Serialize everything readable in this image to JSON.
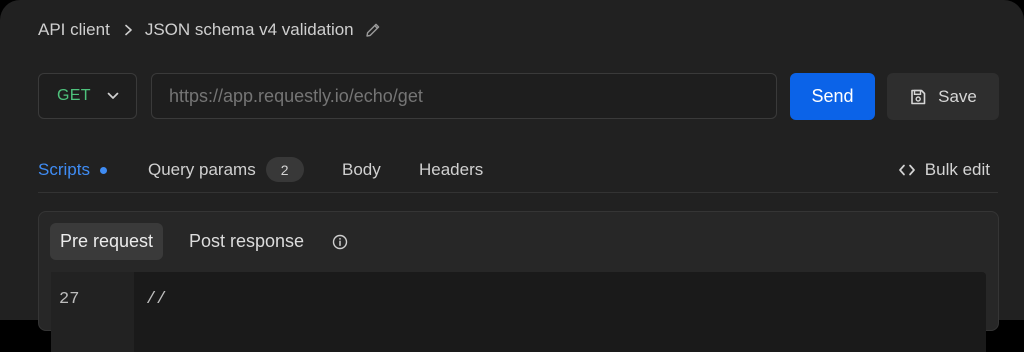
{
  "breadcrumb": {
    "root": "API client",
    "current": "JSON schema v4 validation",
    "separator_icon": "chevron-right-icon",
    "edit_icon": "pencil-icon"
  },
  "request": {
    "method": "GET",
    "method_color": "#4ec27c",
    "url_placeholder": "https://app.requestly.io/echo/get",
    "send_label": "Send",
    "send_color": "#0b63e8",
    "save_label": "Save",
    "save_icon": "floppy-disk-icon"
  },
  "tabs": [
    {
      "label": "Scripts",
      "active": true,
      "dot": true
    },
    {
      "label": "Query params",
      "count": "2"
    },
    {
      "label": "Body"
    },
    {
      "label": "Headers"
    }
  ],
  "bulk_edit": {
    "label": "Bulk edit",
    "icon": "code-brackets-icon"
  },
  "scripts": {
    "subtabs": [
      {
        "label": "Pre request",
        "active": true
      },
      {
        "label": "Post response"
      }
    ],
    "info_icon": "info-icon",
    "editor": {
      "line_number": "27",
      "line_text": "//"
    }
  },
  "accent_color": "#3f8cf4"
}
